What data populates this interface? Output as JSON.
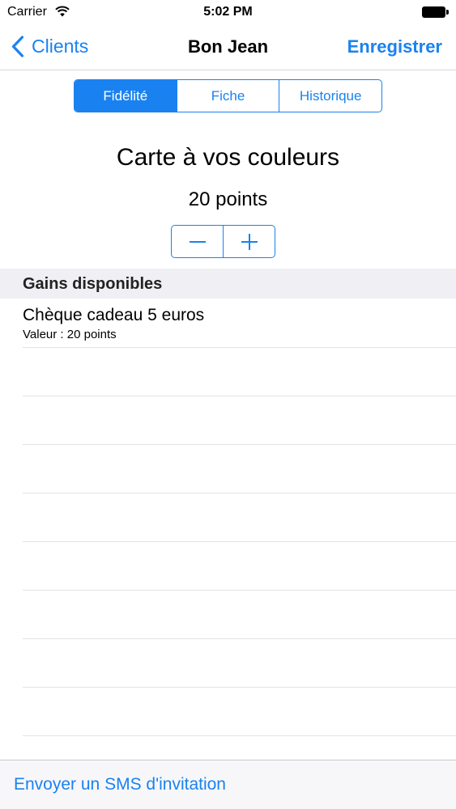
{
  "status_bar": {
    "carrier": "Carrier",
    "time": "5:02 PM"
  },
  "nav": {
    "back_label": "Clients",
    "title": "Bon Jean",
    "save_label": "Enregistrer"
  },
  "segments": [
    {
      "label": "Fidélité",
      "selected": true
    },
    {
      "label": "Fiche",
      "selected": false
    },
    {
      "label": "Historique",
      "selected": false
    }
  ],
  "card": {
    "title": "Carte à vos couleurs",
    "points": "20 points"
  },
  "section": {
    "header": "Gains disponibles",
    "rewards": [
      {
        "title": "Chèque cadeau 5 euros",
        "subtitle": "Valeur : 20 points"
      }
    ]
  },
  "toolbar": {
    "sms_label": "Envoyer un SMS d'invitation"
  },
  "colors": {
    "accent": "#1a82f0",
    "section_bg": "#efeff4",
    "toolbar_bg": "#f7f7f9"
  }
}
